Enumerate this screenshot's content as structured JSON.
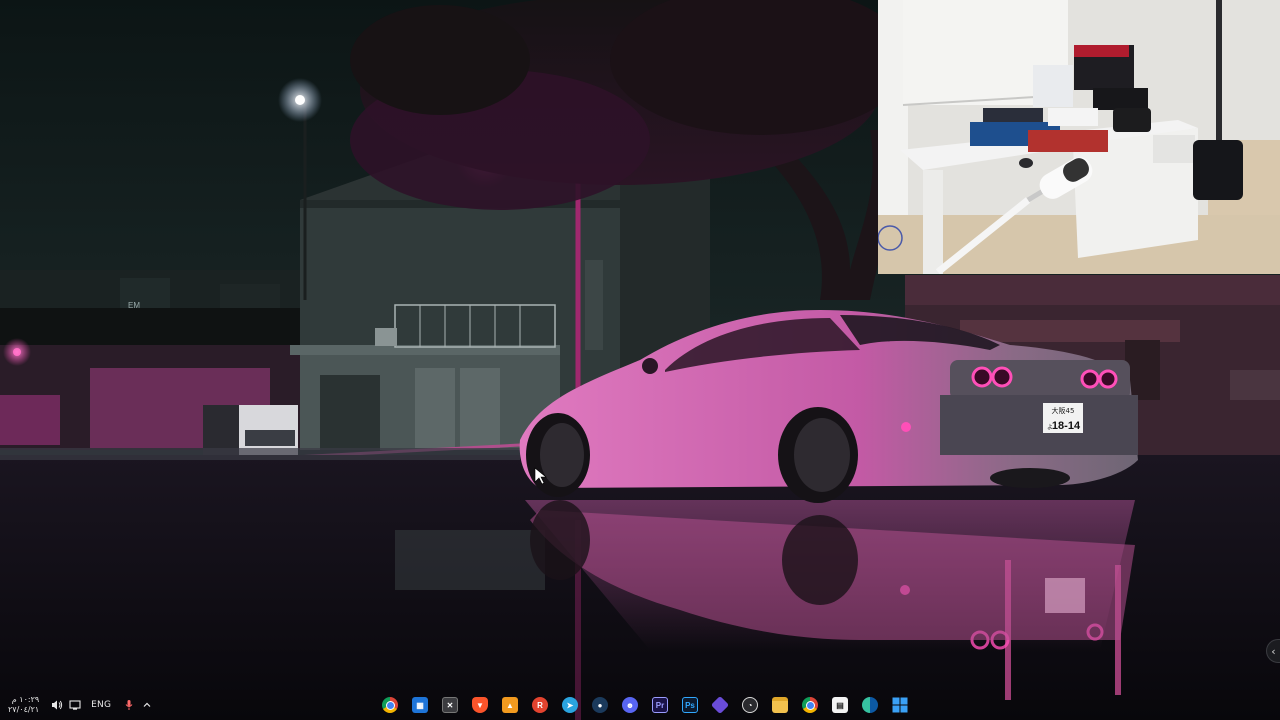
{
  "taskbar": {
    "clock": {
      "time": "١٠:٢٩ م",
      "date": "٢٧/٠٤/٢١"
    },
    "tray_icons": [
      "volume-icon",
      "network-icon"
    ],
    "language": "ENG",
    "tray_extra_icons": [
      "microphone-icon",
      "chevron-up-icon"
    ],
    "pinned_apps": [
      "chrome-icon",
      "apps-grid-icon",
      "terminal-icon",
      "brave-icon",
      "vlc-icon",
      "rockstar-icon",
      "telegram-icon",
      "steam-icon",
      "discord-icon",
      "premiere-icon",
      "photoshop-icon",
      "app-diamond-icon",
      "obs-icon",
      "file-explorer-icon",
      "chrome-profile-icon",
      "microsoft-store-icon",
      "edge-icon",
      "windows-start-icon"
    ],
    "tile_text": {
      "premiere": "Pr",
      "photoshop": "Ps"
    }
  },
  "wallpaper": {
    "plate_top": "大阪45",
    "plate_number": "18-14",
    "plate_letter": "よ",
    "sign": "EM"
  },
  "colors": {
    "accent_pink": "#ff4fb8",
    "sky": "#0f1c1c",
    "ground": "#0c0a10"
  },
  "side_handle": {
    "icon": "chevron-left-icon"
  }
}
